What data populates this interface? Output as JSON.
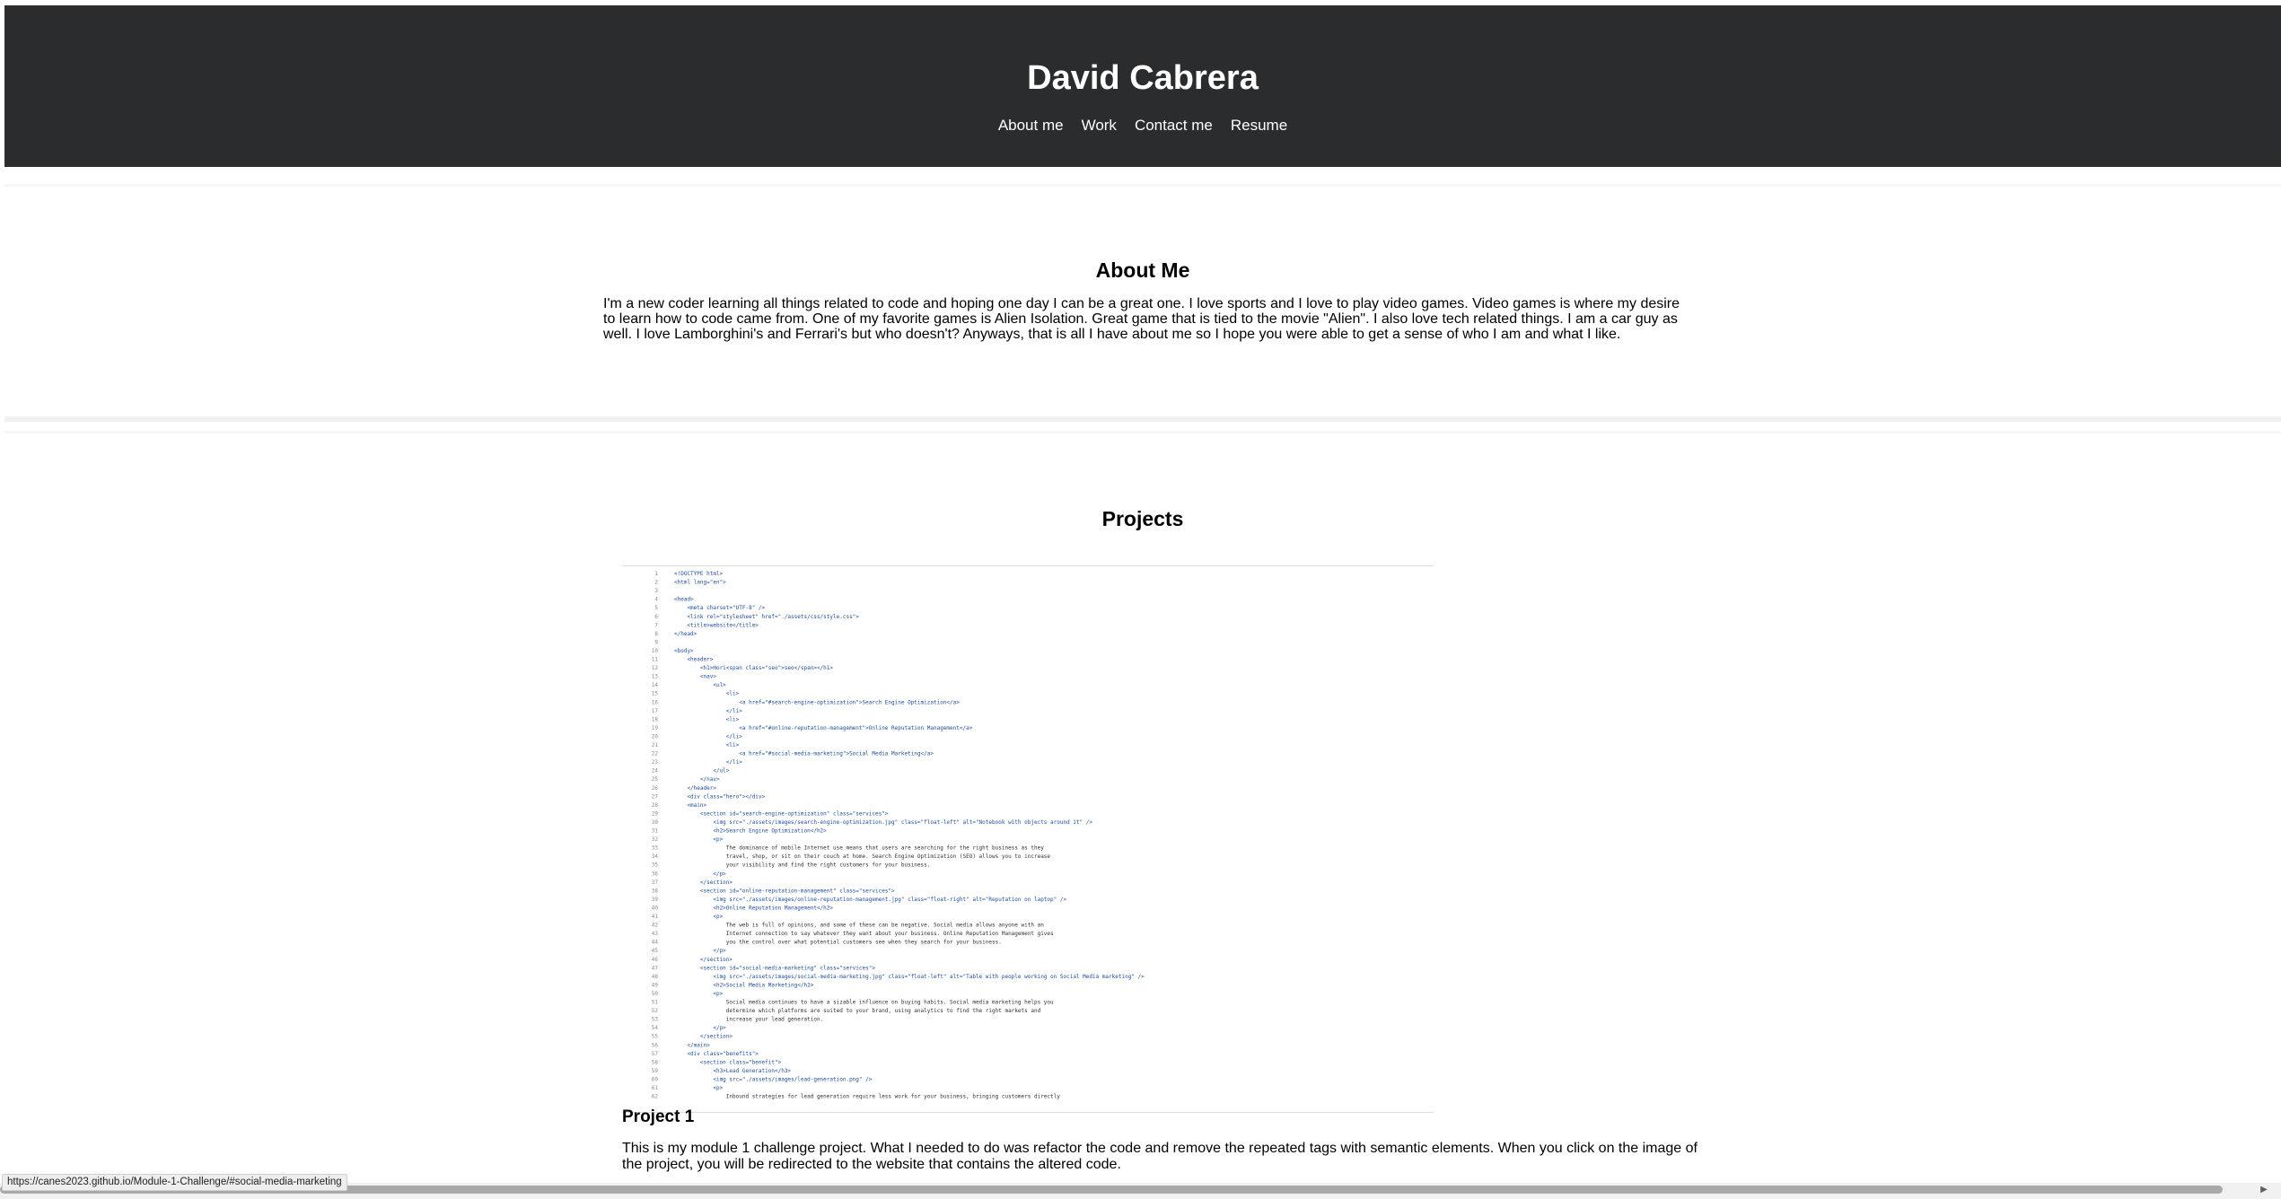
{
  "header": {
    "title": "David Cabrera",
    "nav": [
      {
        "label": "About me"
      },
      {
        "label": "Work"
      },
      {
        "label": "Contact me"
      },
      {
        "label": "Resume"
      }
    ]
  },
  "about": {
    "heading": "About Me",
    "text": "I'm a new coder learning all things related to code and hoping one day I can be a great one. I love sports and I love to play video games. Video games is where my desire to learn how to code came from. One of my favorite games is Alien Isolation. Great game that is tied to the movie \"Alien\". I also love tech related things. I am a car guy as well. I love Lamborghini's and Ferrari's but who doesn't? Anyways, that is all I have about me so I hope you were able to get a sense of who I am and what I like."
  },
  "projects": {
    "heading": "Projects",
    "items": [
      {
        "title": "Project 1",
        "description": "This is my module 1 challenge project. What I needed to do was refactor the code and remove the repeated tags with semantic elements. When you click on the image of the project, you will be redirected to the website that contains the altered code.",
        "image_code_lines": [
          "<!DOCTYPE html>",
          "<html lang=\"en\">",
          "",
          "<head>",
          "    <meta charset=\"UTF-8\" />",
          "    <link rel=\"stylesheet\" href=\"./assets/css/style.css\">",
          "    <title>website</title>",
          "</head>",
          "",
          "<body>",
          "    <header>",
          "        <h1>Hori<span class=\"seo\">seo</span></h1>",
          "        <nav>",
          "            <ul>",
          "                <li>",
          "                    <a href=\"#search-engine-optimization\">Search Engine Optimization</a>",
          "                </li>",
          "                <li>",
          "                    <a href=\"#online-reputation-management\">Online Reputation Management</a>",
          "                </li>",
          "                <li>",
          "                    <a href=\"#social-media-marketing\">Social Media Marketing</a>",
          "                </li>",
          "            </ul>",
          "        </nav>",
          "    </header>",
          "    <div class=\"hero\"></div>",
          "    <main>",
          "        <section id=\"search-engine-optimization\" class=\"services\">",
          "            <img src=\"./assets/images/search-engine-optimization.jpg\" class=\"float-left\" alt=\"Notebook with objects around it\" />",
          "            <h2>Search Engine Optimization</h2>",
          "            <p>",
          "                The dominance of mobile Internet use means that users are searching for the right business as they",
          "                travel, shop, or sit on their couch at home. Search Engine Optimization (SEO) allows you to increase",
          "                your visibility and find the right customers for your business.",
          "            </p>",
          "        </section>",
          "        <section id=\"online-reputation-management\" class=\"services\">",
          "            <img src=\"./assets/images/online-reputation-management.jpg\" class=\"float-right\" alt=\"Reputation on laptop\" />",
          "            <h2>Online Reputation Management</h2>",
          "            <p>",
          "                The web is full of opinions, and some of these can be negative. Social media allows anyone with an",
          "                Internet connection to say whatever they want about your business. Online Reputation Management gives",
          "                you the control over what potential customers see when they search for your business.",
          "            </p>",
          "        </section>",
          "        <section id=\"social-media-marketing\" class=\"services\">",
          "            <img src=\"./assets/images/social-media-marketing.jpg\" class=\"float-left\" alt=\"Table with people working on Social Media marketing\" />",
          "            <h2>Social Media Marketing</h2>",
          "            <p>",
          "                Social media continues to have a sizable influence on buying habits. Social media marketing helps you",
          "                determine which platforms are suited to your brand, using analytics to find the right markets and",
          "                increase your lead generation.",
          "            </p>",
          "        </section>",
          "    </main>",
          "    <div class=\"benefits\">",
          "        <section class=\"benefit\">",
          "            <h3>Lead Generation</h3>",
          "            <img src=\"./assets/images/lead-generation.png\" />",
          "            <p>",
          "                Inbound strategies for lead generation require less work for your business, bringing customers directly"
        ]
      }
    ]
  },
  "status_bar": {
    "url": "https://canes2023.github.io/Module-1-Challenge/#social-media-marketing"
  },
  "colors": {
    "header_bg": "#2b2c2d",
    "code_tag": "#1f4fa3",
    "code_text": "#333333",
    "line_number": "#8a8a8a"
  }
}
